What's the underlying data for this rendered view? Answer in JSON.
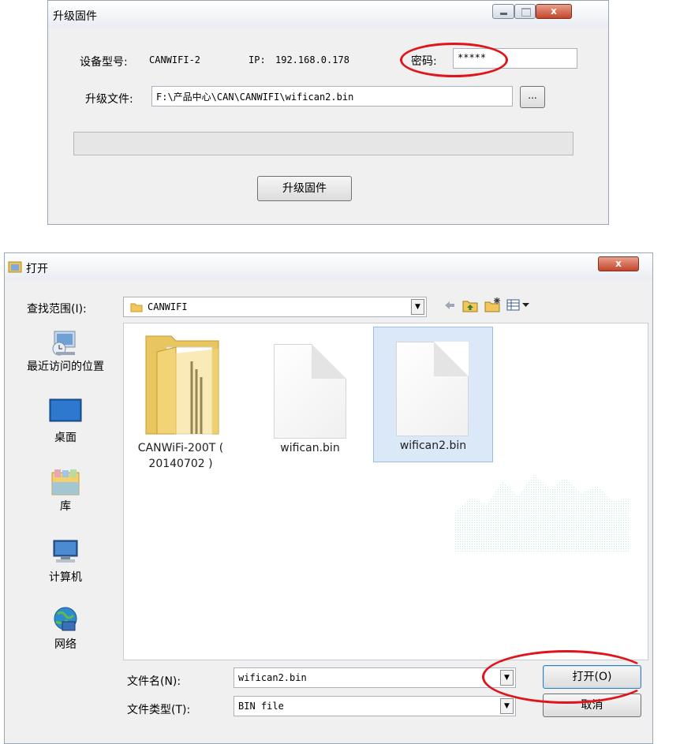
{
  "upgrade_dialog": {
    "title": "升级固件",
    "device_model_label": "设备型号:",
    "device_model_value": "CANWIFI-2",
    "ip_label": "IP:",
    "ip_value": "192.168.0.178",
    "password_label": "密码:",
    "password_value": "*****",
    "file_label": "升级文件:",
    "file_value": "F:\\产品中心\\CAN\\CANWIFI\\wifican2.bin",
    "browse_label": "...",
    "upgrade_button": "升级固件",
    "close_glyph": "x"
  },
  "open_dialog": {
    "title": "打开",
    "close_glyph": "x",
    "look_in_label": "查找范围(I):",
    "look_in_value": "CANWIFI",
    "places": [
      {
        "label": "最近访问的位置",
        "icon": "recent-places-icon"
      },
      {
        "label": "桌面",
        "icon": "desktop-icon"
      },
      {
        "label": "库",
        "icon": "library-icon"
      },
      {
        "label": "计算机",
        "icon": "computer-icon"
      },
      {
        "label": "网络",
        "icon": "network-icon"
      }
    ],
    "files": [
      {
        "name_line1": "CANWiFi-200T (",
        "name_line2": "20140702 )",
        "icon": "folder-icon",
        "selected": false
      },
      {
        "name_line1": "wifican.bin",
        "icon": "document-icon",
        "selected": false
      },
      {
        "name_line1": "wifican2.bin",
        "icon": "document-icon",
        "selected": true
      }
    ],
    "file_name_label": "文件名(N):",
    "file_name_value": "wifican2.bin",
    "file_type_label": "文件类型(T):",
    "file_type_value": "BIN file",
    "open_button": "打开(O)",
    "cancel_button": "取消",
    "dropdown_arrow": "▼",
    "highlight_color": "#e0141b"
  }
}
